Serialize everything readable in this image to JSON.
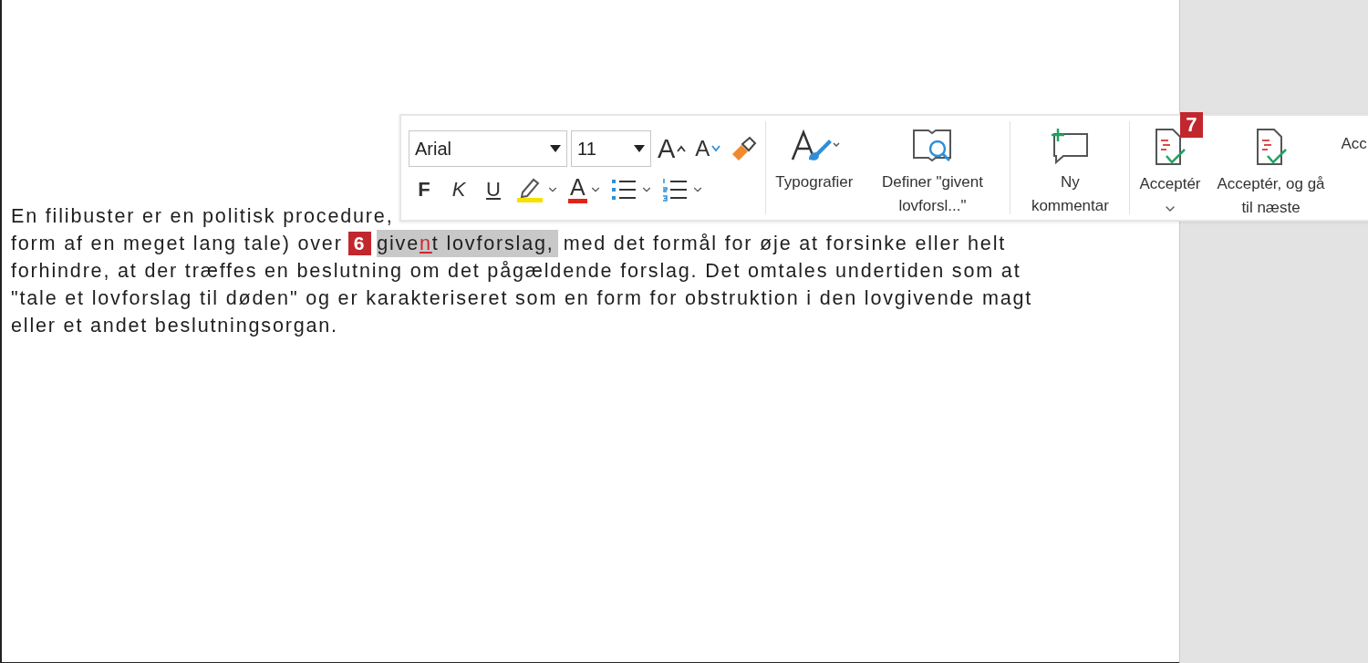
{
  "document": {
    "lines": [
      {
        "text": "En filibuster er en politisk procedure,"
      },
      {
        "text": "form af en meget lang tale) over",
        "callout": "6",
        "selection": {
          "before": "give",
          "inserted": "n",
          "after": "t lovforslag,"
        },
        "rest": "med det formål for øje at forsinke eller helt"
      },
      {
        "text": "forhindre, at der træffes en beslutning om det pågældende forslag. Det omtales undertiden som at"
      },
      {
        "text": "\"tale et lovforslag til døden\" og er karakteriseret som en form for obstruktion i den lovgivende magt"
      },
      {
        "text": "eller et andet beslutningsorgan."
      }
    ]
  },
  "toolbar": {
    "font": {
      "value": "Arial"
    },
    "size": {
      "value": "11"
    },
    "size_buttons": [
      {
        "kind": "grow",
        "glyph": "A"
      },
      {
        "kind": "shrink",
        "glyph": "A"
      }
    ],
    "format_buttons": [
      {
        "kind": "bold",
        "label": "F"
      },
      {
        "kind": "italic",
        "label": "K"
      },
      {
        "kind": "underline",
        "label": "U"
      }
    ],
    "font_color": {
      "glyph": "A"
    },
    "groups": [
      [
        {
          "kind": "styles",
          "label": "Typografier"
        },
        {
          "kind": "define",
          "label": "Definer \"givent lovforsl...\""
        }
      ],
      [
        {
          "kind": "comment",
          "label": "Ny kommentar"
        }
      ],
      [
        {
          "kind": "accept",
          "label": "Acceptér",
          "callout": "7"
        },
        {
          "kind": "accept_next",
          "label": "Acceptér, og gå til næste"
        },
        {
          "kind": "accept_cut",
          "label": "Acc"
        }
      ]
    ]
  }
}
